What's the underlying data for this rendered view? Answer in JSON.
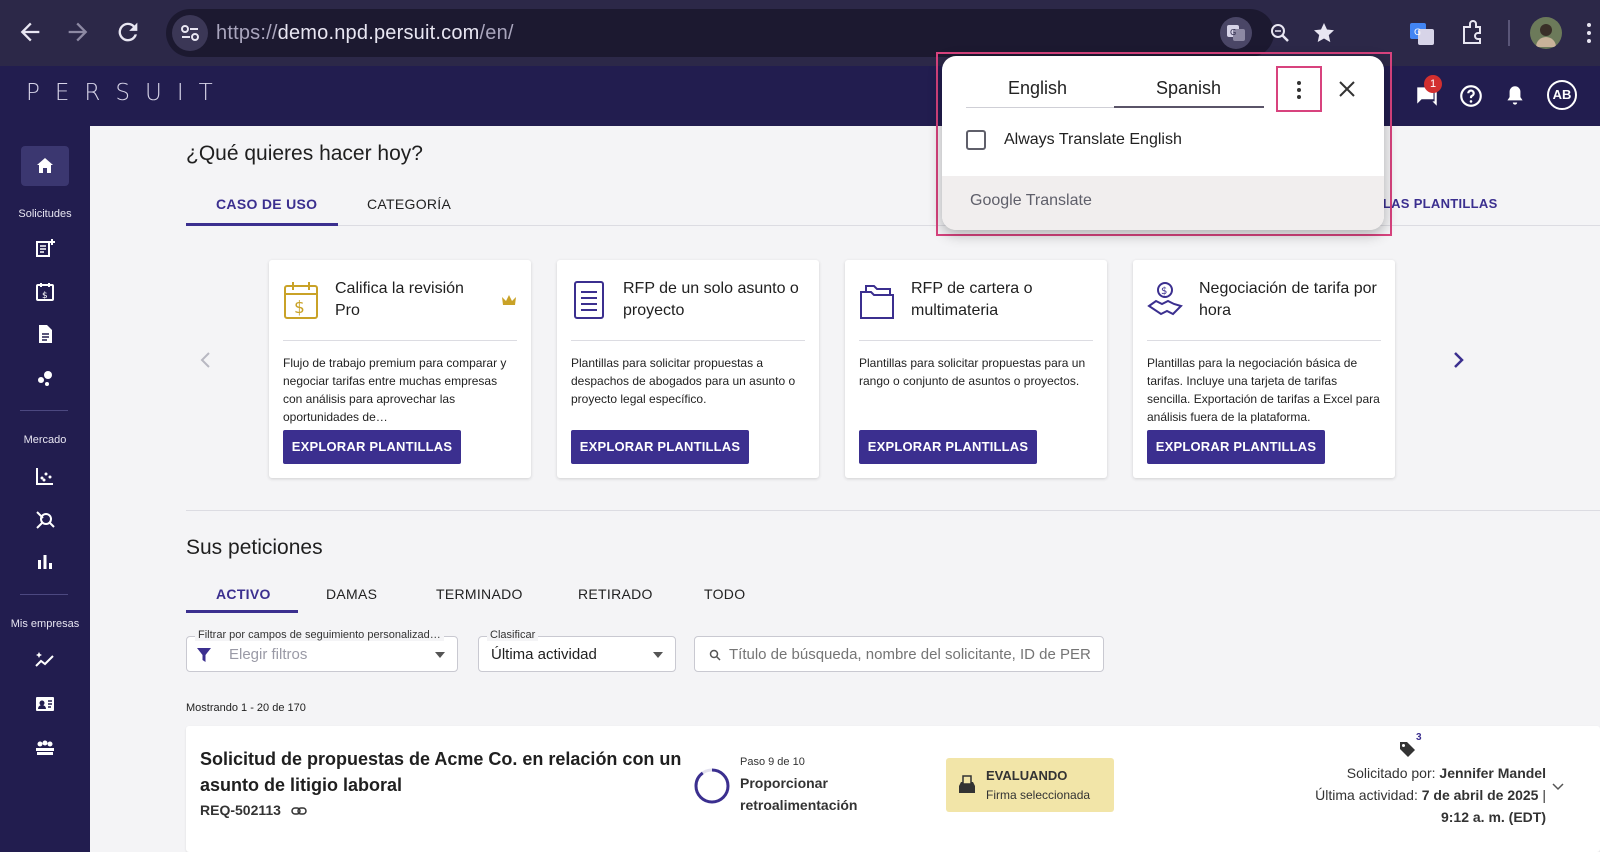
{
  "browser": {
    "url_prefix": "https://",
    "url_host": "demo.npd.persuit.com",
    "url_path": "/en/"
  },
  "app": {
    "logo": "PERSUIT",
    "notification_count": "1",
    "avatar_initials": "AB"
  },
  "sidebar": {
    "section_requests": "Solicitudes",
    "section_market": "Mercado",
    "section_firms": "Mis empresas"
  },
  "main": {
    "heading": "¿Qué quieres hacer hoy?",
    "tabs": [
      {
        "label": "CASO DE USO"
      },
      {
        "label": "CATEGORÍA"
      }
    ],
    "all_templates_link": "S LAS PLANTILLAS",
    "cards": [
      {
        "title": "Califica la revisión Pro",
        "description": "Flujo de trabajo premium para comparar y negociar tarifas entre muchas empresas con análisis para aprovechar las oportunidades de…",
        "button": "EXPLORAR PLANTILLAS"
      },
      {
        "title": "RFP de un solo asunto o proyecto",
        "description": "Plantillas para solicitar propuestas a despachos de abogados para un asunto o proyecto legal específico.",
        "button": "EXPLORAR PLANTILLAS"
      },
      {
        "title": "RFP de cartera o multimateria",
        "description": "Plantillas para solicitar propuestas para un rango o conjunto de asuntos o proyectos.",
        "button": "EXPLORAR PLANTILLAS"
      },
      {
        "title": "Negociación de tarifa por hora",
        "description": "Plantillas para la negociación básica de tarifas. Incluye una tarjeta de tarifas sencilla. Exportación de tarifas a Excel para análisis fuera de la plataforma.",
        "button": "EXPLORAR PLANTILLAS"
      }
    ],
    "requests_heading": "Sus peticiones",
    "request_tabs": [
      {
        "label": "ACTIVO"
      },
      {
        "label": "DAMAS"
      },
      {
        "label": "TERMINADO"
      },
      {
        "label": "RETIRADO"
      },
      {
        "label": "TODO"
      }
    ],
    "filter": {
      "label": "Filtrar por campos de seguimiento personalizad…",
      "placeholder": "Elegir filtros"
    },
    "sort": {
      "label": "Clasificar",
      "value": "Última actividad"
    },
    "search": {
      "placeholder": "Título de búsqueda, nombre del solicitante, ID de PERSUIT"
    },
    "showing": "Mostrando 1 - 20 de 170",
    "request": {
      "title": "Solicitud de propuestas de Acme Co. en relación con un asunto de litigio laboral",
      "id": "REQ-502113",
      "step": "Paso 9 de 10",
      "step_name": "Proporcionar retroalimentación",
      "status": "EVALUANDO",
      "status_sub": "Firma seleccionada",
      "tag_count": "3",
      "requested_by_label": "Solicitado por:",
      "requested_by": "Jennifer Mandel",
      "last_activity_label": "Última actividad:",
      "last_activity_date": "7 de abril de 2025",
      "last_activity_sep": "|",
      "last_activity_time": "9:12 a. m. (EDT)"
    }
  },
  "translate_popup": {
    "source_lang": "English",
    "target_lang": "Spanish",
    "always_translate": "Always Translate English",
    "brand_google": "Google",
    "brand_translate": "Translate"
  },
  "colors": {
    "brand": "#221d4f",
    "accent": "#3b2f8f",
    "highlight": "#d8437e",
    "status": "#f2e5a8"
  }
}
